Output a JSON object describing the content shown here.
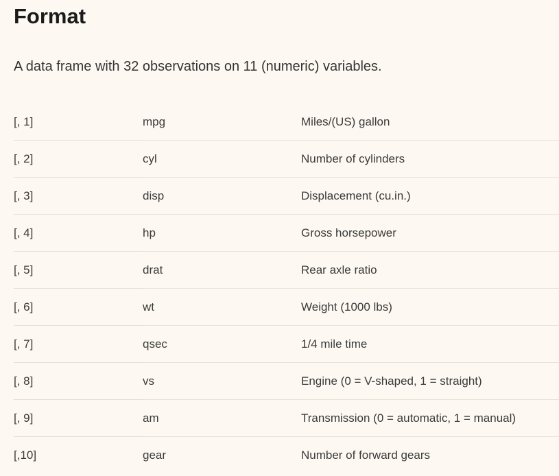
{
  "section": {
    "heading": "Format",
    "description": "A data frame with 32 observations on 11 (numeric) variables."
  },
  "variables": [
    {
      "index": "[, 1]",
      "name": "mpg",
      "description": "Miles/(US) gallon"
    },
    {
      "index": "[, 2]",
      "name": "cyl",
      "description": "Number of cylinders"
    },
    {
      "index": "[, 3]",
      "name": "disp",
      "description": "Displacement (cu.in.)"
    },
    {
      "index": "[, 4]",
      "name": "hp",
      "description": "Gross horsepower"
    },
    {
      "index": "[, 5]",
      "name": "drat",
      "description": "Rear axle ratio"
    },
    {
      "index": "[, 6]",
      "name": "wt",
      "description": "Weight (1000 lbs)"
    },
    {
      "index": "[, 7]",
      "name": "qsec",
      "description": "1/4 mile time"
    },
    {
      "index": "[, 8]",
      "name": "vs",
      "description": "Engine (0 = V-shaped, 1 = straight)"
    },
    {
      "index": "[, 9]",
      "name": "am",
      "description": "Transmission (0 = automatic, 1 = manual)"
    },
    {
      "index": "[,10]",
      "name": "gear",
      "description": "Number of forward gears"
    }
  ],
  "colors": {
    "background": "#fdf9f2",
    "heading": "#1b1b1b",
    "text": "#333333",
    "row_divider": "#e9e3d8"
  }
}
